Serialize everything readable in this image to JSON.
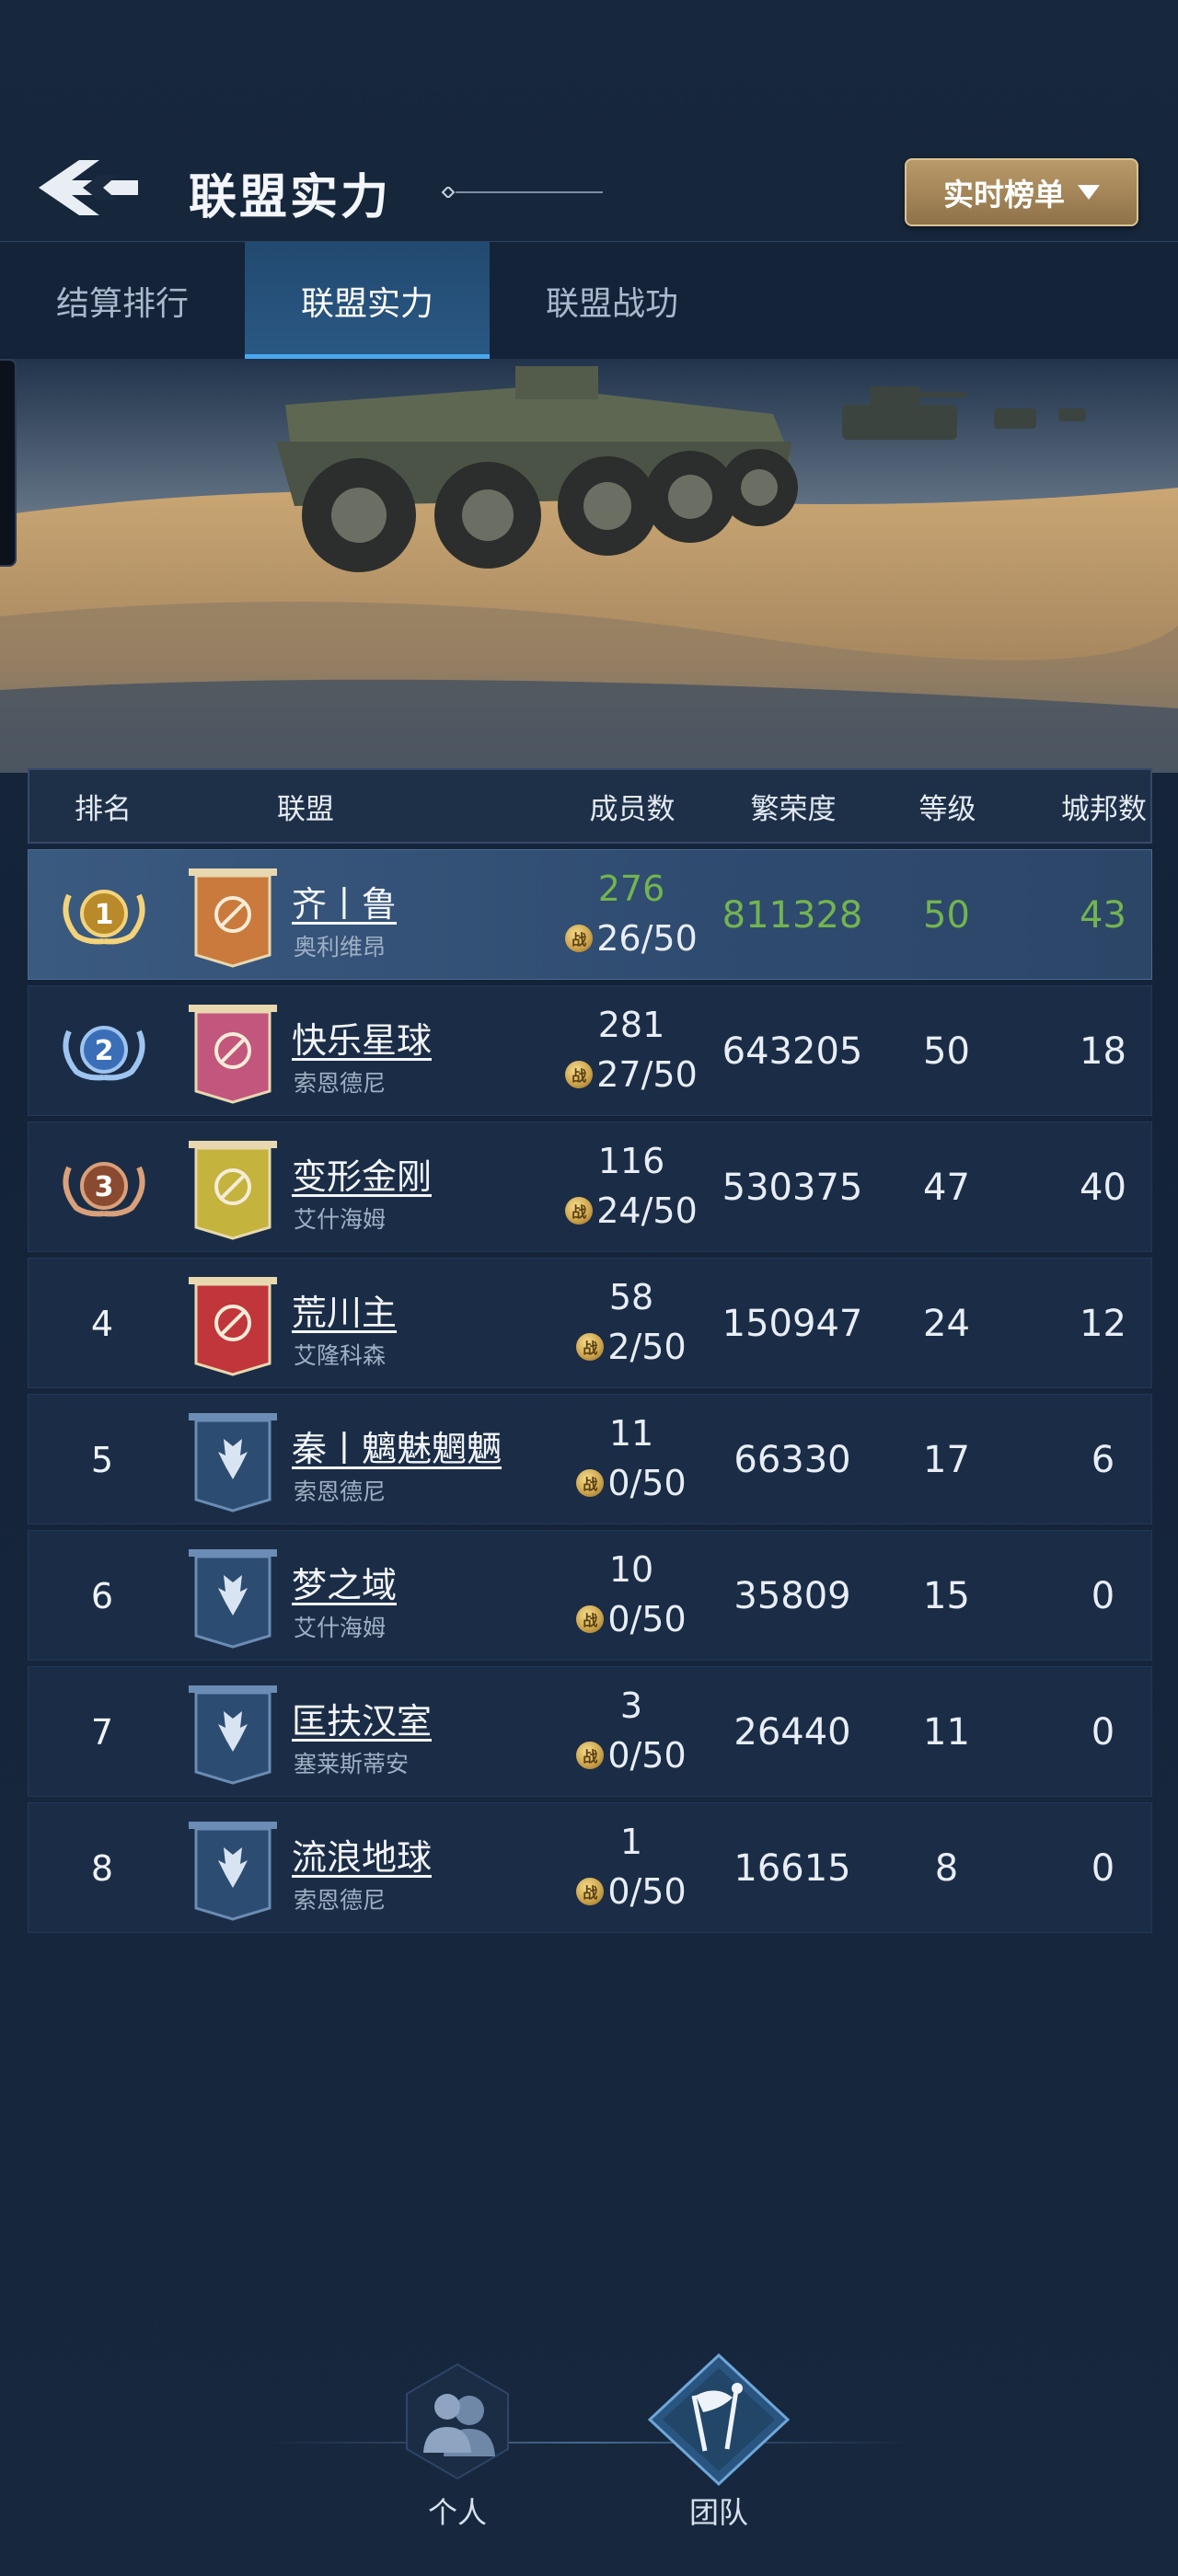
{
  "header": {
    "title": "联盟实力",
    "back_icon": "back-arrow-icon",
    "dropdown_label": "实时榜单"
  },
  "tabs": [
    {
      "label": "结算排行",
      "active": false
    },
    {
      "label": "联盟实力",
      "active": true
    },
    {
      "label": "联盟战功",
      "active": false
    }
  ],
  "table": {
    "headers": [
      "排名",
      "联盟",
      "成员数",
      "繁荣度",
      "等级",
      "城邦数"
    ],
    "rows": [
      {
        "rank": "1",
        "name": "齐丨鲁",
        "server": "奥利维昂",
        "members": "276",
        "capacity": "26/50",
        "prosperity": "811328",
        "level": "50",
        "cities": "43",
        "flag_color": "#c97a3c",
        "highlight": true
      },
      {
        "rank": "2",
        "name": "快乐星球",
        "server": "索恩德尼",
        "members": "281",
        "capacity": "27/50",
        "prosperity": "643205",
        "level": "50",
        "cities": "18",
        "flag_color": "#c2567d"
      },
      {
        "rank": "3",
        "name": "变形金刚",
        "server": "艾什海姆",
        "members": "116",
        "capacity": "24/50",
        "prosperity": "530375",
        "level": "47",
        "cities": "40",
        "flag_color": "#c4b33c"
      },
      {
        "rank": "4",
        "name": "荒川主",
        "server": "艾隆科森",
        "members": "58",
        "capacity": "2/50",
        "prosperity": "150947",
        "level": "24",
        "cities": "12",
        "flag_color": "#c0363a"
      },
      {
        "rank": "5",
        "name": "秦丨魑魅魍魉",
        "server": "索恩德尼",
        "members": "11",
        "capacity": "0/50",
        "prosperity": "66330",
        "level": "17",
        "cities": "6",
        "flag_color": "#2d4c72"
      },
      {
        "rank": "6",
        "name": "梦之域",
        "server": "艾什海姆",
        "members": "10",
        "capacity": "0/50",
        "prosperity": "35809",
        "level": "15",
        "cities": "0",
        "flag_color": "#2d4c72"
      },
      {
        "rank": "7",
        "name": "匡扶汉室",
        "server": "塞莱斯蒂安",
        "members": "3",
        "capacity": "0/50",
        "prosperity": "26440",
        "level": "11",
        "cities": "0",
        "flag_color": "#2d4c72"
      },
      {
        "rank": "8",
        "name": "流浪地球",
        "server": "索恩德尼",
        "members": "1",
        "capacity": "0/50",
        "prosperity": "16615",
        "level": "8",
        "cities": "0",
        "flag_color": "#2d4c72"
      }
    ],
    "coin_glyph": "战"
  },
  "bottom_nav": [
    {
      "label": "个人",
      "icon": "people-icon"
    },
    {
      "label": "团队",
      "icon": "team-flag-icon"
    }
  ],
  "colors": {
    "highlight_green": "#73b44f",
    "accent_blue": "#4aa8ef",
    "gold_button": "#b99a69"
  }
}
